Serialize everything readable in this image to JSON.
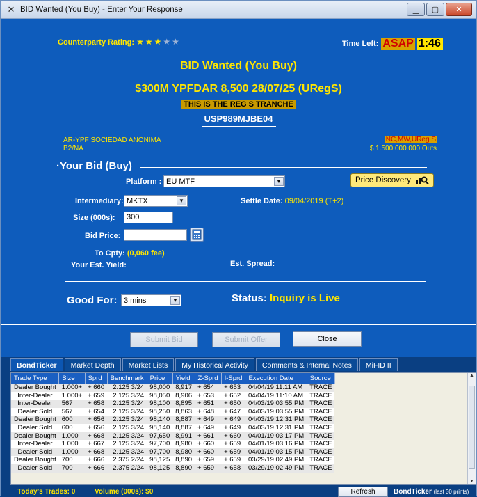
{
  "window": {
    "title": "BID Wanted (You Buy) - Enter Your Response"
  },
  "header": {
    "counterparty_label": "Counterparty Rating:",
    "rating": 3,
    "rating_max": 5,
    "time_left_label": "Time Left:",
    "time_asap": "ASAP",
    "time_value": "1:46",
    "heading": "BID Wanted (You Buy)",
    "bond": "$300M YPFDAR 8,500 28/07/25 (URegS)",
    "tranche": "THIS IS THE REG S TRANCHE",
    "isin": "USP989MJBE04",
    "issuer": "AR-YPF SOCIEDAD ANONIMA",
    "rating_code": "B2/NA",
    "flags": "NC,MW,UReg S",
    "outstanding": "$ 1.500.000.000 Outs"
  },
  "form": {
    "section_title": "Your Bid (Buy)",
    "platform_label": "Platform :",
    "platform_value": "EU MTF",
    "price_discovery": "Price Discovery",
    "intermediary_label": "Intermediary:",
    "intermediary_value": "MKTX",
    "settle_label": "Settle Date:",
    "settle_value": "09/04/2019 (T+2)",
    "size_label": "Size (000s):",
    "size_value": "300",
    "bid_price_label": "Bid Price:",
    "bid_price_value": "",
    "to_cpty_label": "To Cpty:",
    "to_cpty_value": "(0,060 fee)",
    "est_yield_label": "Your Est. Yield:",
    "est_spread_label": "Est. Spread:",
    "good_for_label": "Good For:",
    "good_for_value": "3 mins",
    "status_label": "Status:",
    "status_value": "Inquiry is Live"
  },
  "actions": {
    "submit_bid": "Submit Bid",
    "submit_offer": "Submit Offer",
    "close": "Close"
  },
  "tabs": [
    "BondTicker",
    "Market Depth",
    "Market Lists",
    "My Historical Activity",
    "Comments & Internal Notes",
    "MiFID II"
  ],
  "table": {
    "columns": [
      "Trade Type",
      "Size",
      "Sprd",
      "Benchmark",
      "Price",
      "Yield",
      "Z-Sprd",
      "I-Sprd",
      "Execution Date",
      "Source"
    ],
    "rows": [
      [
        "Dealer Bought",
        "1.000+",
        "+ 660",
        "2.125  3/24",
        "98,000",
        "8,917",
        "+ 654",
        "+ 653",
        "04/04/19 11:11 AM",
        "TRACE"
      ],
      [
        "Inter-Dealer",
        "1.000+",
        "+ 659",
        "2.125  3/24",
        "98,050",
        "8,906",
        "+ 653",
        "+ 652",
        "04/04/19 11:10 AM",
        "TRACE"
      ],
      [
        "Inter-Dealer",
        "567",
        "+ 658",
        "2.125  3/24",
        "98,100",
        "8,895",
        "+ 651",
        "+ 650",
        "04/03/19 03:55 PM",
        "TRACE"
      ],
      [
        "Dealer Sold",
        "567",
        "+ 654",
        "2.125  3/24",
        "98,250",
        "8,863",
        "+ 648",
        "+ 647",
        "04/03/19 03:55 PM",
        "TRACE"
      ],
      [
        "Dealer Bought",
        "600",
        "+ 656",
        "2.125  3/24",
        "98,140",
        "8,887",
        "+ 649",
        "+ 649",
        "04/03/19 12:31 PM",
        "TRACE"
      ],
      [
        "Dealer Sold",
        "600",
        "+ 656",
        "2.125  3/24",
        "98,140",
        "8,887",
        "+ 649",
        "+ 649",
        "04/03/19 12:31 PM",
        "TRACE"
      ],
      [
        "Dealer Bought",
        "1.000",
        "+ 668",
        "2.125  3/24",
        "97,650",
        "8,991",
        "+ 661",
        "+ 660",
        "04/01/19 03:17 PM",
        "TRACE"
      ],
      [
        "Inter-Dealer",
        "1.000",
        "+ 667",
        "2.125  3/24",
        "97,700",
        "8,980",
        "+ 660",
        "+ 659",
        "04/01/19 03:16 PM",
        "TRACE"
      ],
      [
        "Dealer Sold",
        "1.000",
        "+ 668",
        "2.125  3/24",
        "97,700",
        "8,980",
        "+ 660",
        "+ 659",
        "04/01/19 03:15 PM",
        "TRACE"
      ],
      [
        "Dealer Bought",
        "700",
        "+ 666",
        "2.375  2/24",
        "98,125",
        "8,890",
        "+ 659",
        "+ 659",
        "03/29/19 02:49 PM",
        "TRACE"
      ],
      [
        "Dealer Sold",
        "700",
        "+ 666",
        "2.375  2/24",
        "98,125",
        "8,890",
        "+ 659",
        "+ 658",
        "03/29/19 02:49 PM",
        "TRACE"
      ]
    ]
  },
  "footer": {
    "todays_trades_label": "Today's Trades:",
    "todays_trades_value": "0",
    "volume_label": "Volume (000s):",
    "volume_value": "$0",
    "refresh": "Refresh",
    "ticker_label": "BondTicker",
    "ticker_note": "(last 30 prints)"
  },
  "colors": {
    "panel": "#0e5cbc",
    "accent": "#ffe600",
    "status": "#ffe600"
  }
}
